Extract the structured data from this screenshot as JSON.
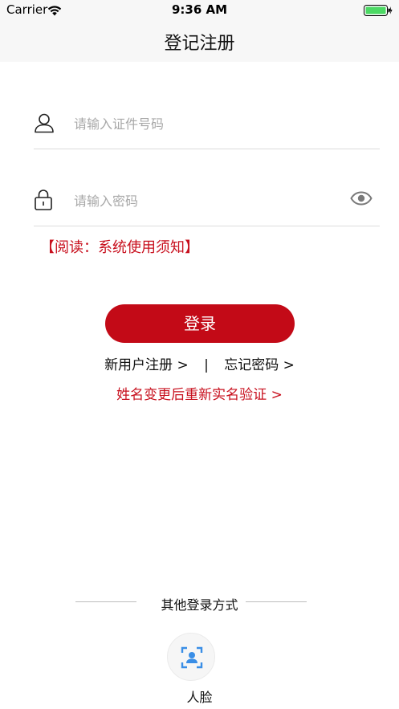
{
  "status_bar": {
    "carrier": "Carrier",
    "time": "9:36 AM",
    "battery_color": "#4cd964"
  },
  "nav": {
    "title": "登记注册"
  },
  "form": {
    "id_placeholder": "请输入证件号码",
    "id_value": "",
    "id_icon": "user-icon",
    "password_placeholder": "请输入密码",
    "password_value": "",
    "password_icon": "lock-icon",
    "toggle_icon": "eye-icon"
  },
  "notice_link": "【阅读：系统使用须知】",
  "login_button": "登录",
  "links": {
    "register": "新用户注册 >",
    "separator": "|",
    "forgot": "忘记密码 >",
    "rename_verify": "姓名变更后重新实名验证 >"
  },
  "other_login": {
    "title": "其他登录方式",
    "face_label": "人脸",
    "face_icon": "face-scan-icon"
  },
  "colors": {
    "accent": "#c30a17",
    "link_red": "#c8101e",
    "icon_blue": "#3a8ee6"
  }
}
